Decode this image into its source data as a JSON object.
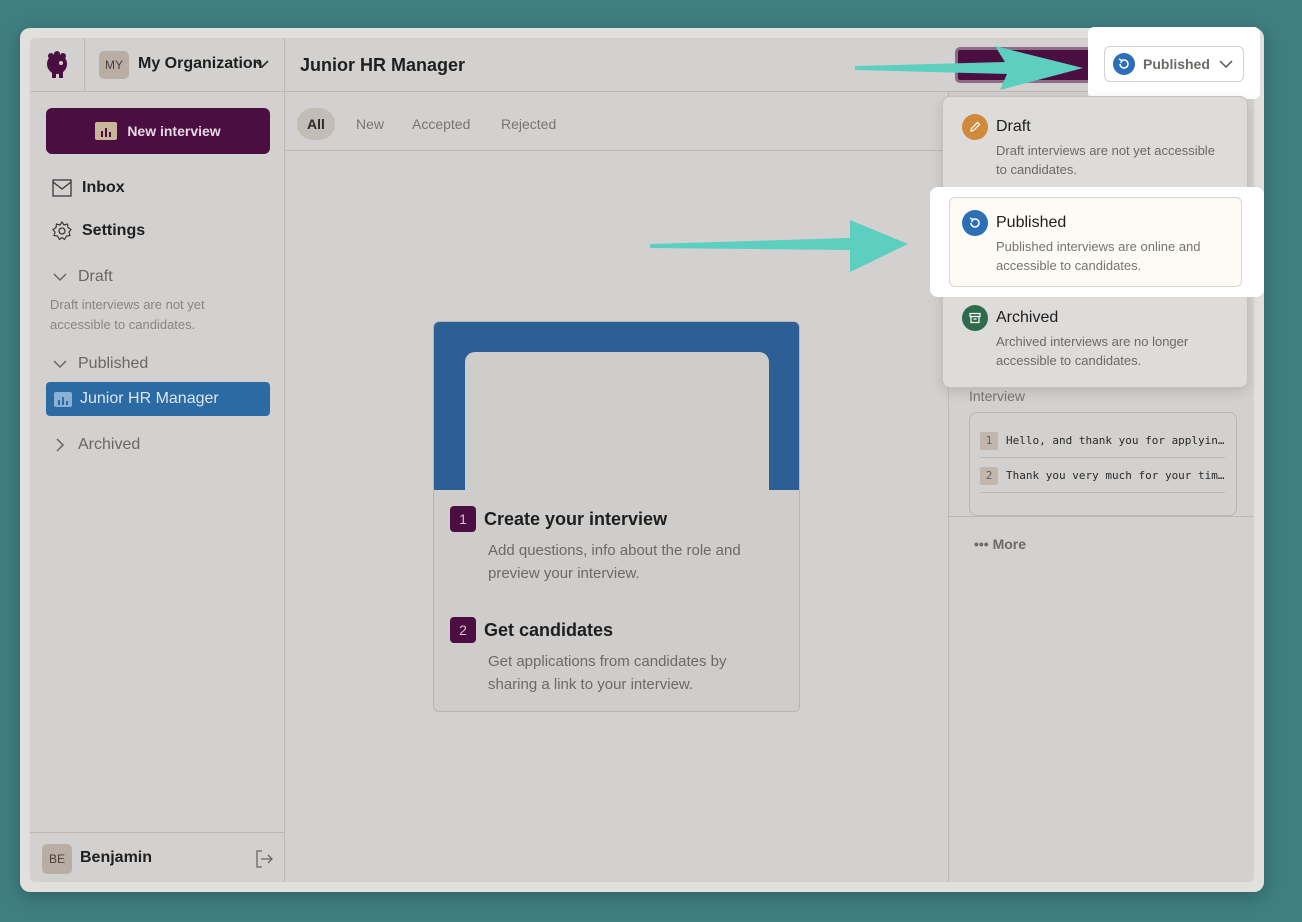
{
  "org": {
    "avatar": "MY",
    "name": "My Organization"
  },
  "sidebar": {
    "new_interview": "New interview",
    "inbox": "Inbox",
    "settings": "Settings",
    "draft": {
      "label": "Draft",
      "desc": "Draft interviews are not yet accessible to candidates."
    },
    "published": {
      "label": "Published"
    },
    "active_item": "Junior HR Manager",
    "archived": {
      "label": "Archived"
    }
  },
  "user": {
    "avatar": "BE",
    "name": "Benjamin"
  },
  "header": {
    "title": "Junior HR Manager",
    "status": "Published"
  },
  "tabs": [
    "All",
    "New",
    "Accepted",
    "Rejected"
  ],
  "onboarding": {
    "steps": [
      {
        "num": "1",
        "title": "Create your interview",
        "desc": "Add questions, info about the role and preview your interview."
      },
      {
        "num": "2",
        "title": "Get candidates",
        "desc": "Get applications from candidates by sharing a link to your interview."
      }
    ]
  },
  "right_panel": {
    "interview_label": "Interview",
    "rows": [
      {
        "num": "1",
        "text": "Hello, and thank you for applyin…"
      },
      {
        "num": "2",
        "text": "Thank you very much for your tim…"
      }
    ],
    "more": "••• More"
  },
  "status_menu": {
    "draft": {
      "title": "Draft",
      "desc": "Draft interviews are not yet accessible to candidates."
    },
    "published": {
      "title": "Published",
      "desc": "Published interviews are online and accessible to candidates."
    },
    "archived": {
      "title": "Archived",
      "desc": "Archived interviews are no longer accessible to candidates."
    }
  },
  "colors": {
    "brand": "#4a0f40",
    "published": "#2c6fb7",
    "draft": "#d08a3c",
    "archived": "#2e6b4d",
    "arrow": "#5ccfc0"
  }
}
